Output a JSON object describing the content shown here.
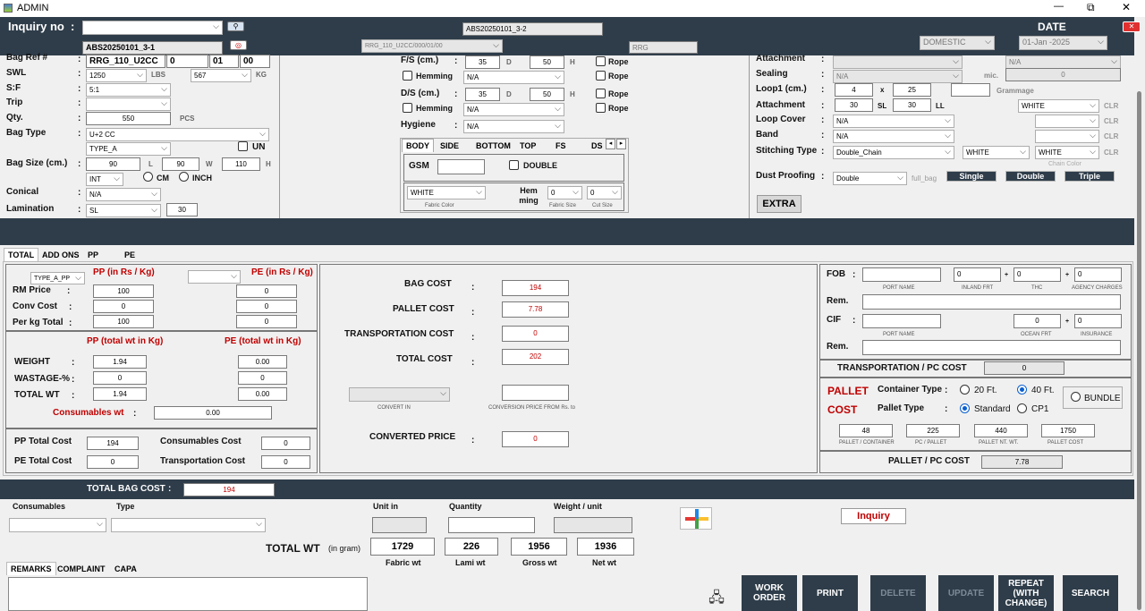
{
  "window": {
    "title": "ADMIN",
    "minimize": "—",
    "maximize": "⧉",
    "close": "✕"
  },
  "header": {
    "inquiry_label": "Inquiry no",
    "colon": ":",
    "inquiry_value": "",
    "inquiry_no_2": "ABS20250101_3-1",
    "center_value": "ABS20250101_3-2",
    "rrg_select": "RRG_110_U2CC/000/01/00",
    "rrg_text": "RRG",
    "date_label": "DATE",
    "market": "DOMESTIC",
    "date_value": "01-Jan -2025"
  },
  "left": {
    "bagref_label": "Bag Ref #",
    "bagref_value": "RRG_110_U2CC",
    "bagref_2": "0",
    "bagref_3": "01",
    "bagref_4": "00",
    "swl_label": "SWL",
    "swl_value": "1250",
    "lbs_label": "LBS",
    "lbs_value": "567",
    "kg_label": "KG",
    "sf_label": "S:F",
    "sf_value": "5:1",
    "trip_label": "Trip",
    "trip_value": "",
    "qty_label": "Qty.",
    "qty_value": "550",
    "pcs_label": "PCS",
    "bagtype_label": "Bag Type",
    "bagtype_value": "U+2 CC",
    "bagtype_sub": "TYPE_A",
    "un_label": "UN",
    "bagsize_label": "Bag Size (cm.)",
    "bs_l": "90",
    "l_label": "L",
    "bs_w": "90",
    "w_label": "W",
    "bs_h": "110",
    "h_label": "H",
    "unit_select": "INT",
    "cm_label": "CM",
    "inch_label": "INCH",
    "conical_label": "Conical",
    "conical_value": "N/A",
    "lamination_label": "Lamination",
    "lamination_value": "SL",
    "lamination_num": "30"
  },
  "mid": {
    "fs_label": "F/S (cm.)",
    "fs_d": "35",
    "fs_h": "50",
    "d_label": "D",
    "h_label": "H",
    "rope_label": "Rope",
    "hemming_label": "Hemming",
    "hem_value": "N/A",
    "ds_label": "D/S (cm.)",
    "ds_d": "35",
    "ds_h": "50",
    "hygiene_label": "Hygiene",
    "hygiene_value": "N/A",
    "tabs": [
      "BODY",
      "SIDE",
      "BOTTOM",
      "TOP",
      "FS",
      "DS"
    ],
    "gsm_label": "GSM",
    "gsm_value": "",
    "double_label": "DOUBLE",
    "fabric_color": "WHITE",
    "fabric_color_label": "Fabric Color",
    "hem_label": "Hem ming",
    "fabric_size": "0",
    "fabric_size_label": "Fabric Size",
    "cut_size": "0",
    "cut_size_label": "Cut Size"
  },
  "right": {
    "attachment_label": "Attachment",
    "attach_na": "N/A",
    "sealing_label": "Sealing",
    "sealing_value": "N/A",
    "mic_label": "mic.",
    "mic_value": "0",
    "loop1_label": "Loop1 (cm.)",
    "loop1_a": "4",
    "x_label": "x",
    "loop1_b": "25",
    "grammage_label": "Grammage",
    "grammage_value": "",
    "attachment2_label": "Attachment",
    "att_a": "30",
    "sl_label": "SL",
    "att_b": "30",
    "ll_label": "LL",
    "att_color": "WHITE",
    "loopcover_label": "Loop Cover",
    "loopcover_value": "N/A",
    "band_label": "Band",
    "band_value": "N/A",
    "stitching_label": "Stitching Type",
    "stitching_value": "Double_Chain",
    "stitch_c1": "WHITE",
    "stitch_c2": "WHITE",
    "chain_color_label": "Chain Color",
    "dust_label": "Dust Proofing",
    "dust_value": "Double",
    "full_bag_label": "full_bag",
    "single_btn": "Single",
    "double_btn": "Double",
    "triple_btn": "Triple",
    "extra_btn": "EXTRA",
    "clr_label": "CLR"
  },
  "costtabs": [
    "TOTAL",
    "ADD ONS",
    "PP",
    "PE"
  ],
  "rm": {
    "type_select": "TYPE_A_PP",
    "pp_head": "PP (in Rs / Kg)",
    "pe_head": "PE (in Rs / Kg)",
    "rm_price_label": "RM Price",
    "rm_pp": "100",
    "rm_pe": "0",
    "conv_label": "Conv Cost",
    "conv_pp": "0",
    "conv_pe": "0",
    "perkg_label": "Per kg Total",
    "perkg_pp": "100",
    "perkg_pe": "0",
    "pp_wt_head": "PP (total wt in Kg)",
    "pe_wt_head": "PE (total wt in Kg)",
    "weight_label": "WEIGHT",
    "weight_pp": "1.94",
    "weight_pe": "0.00",
    "wastage_label": "WASTAGE-%",
    "wastage_pp": "0",
    "wastage_pe": "0",
    "totalwt_label": "TOTAL WT",
    "totalwt_pp": "1.94",
    "totalwt_pe": "0.00",
    "consumables_wt_label": "Consumables wt",
    "consumables_wt": "0.00",
    "pp_total_label": "PP Total Cost",
    "pp_total": "194",
    "consumables_cost_label": "Consumables Cost",
    "consumables_cost": "0",
    "pe_total_label": "PE Total Cost",
    "pe_total": "0",
    "transport_cost_label": "Transportation Cost",
    "transport_cost": "0"
  },
  "costs": {
    "bag_cost_label": "BAG COST",
    "bag_cost": "194",
    "pallet_cost_label": "PALLET COST",
    "pallet_cost": "7.78",
    "transport_label": "TRANSPORTATION COST",
    "transport": "0",
    "total_cost_label": "TOTAL COST",
    "total_cost": "202",
    "convert_in_label": "CONVERT IN",
    "conversion_label": "CONVERSION PRICE FROM Rs. to",
    "converted_label": "CONVERTED PRICE",
    "converted": "0"
  },
  "freight": {
    "fob_label": "FOB",
    "port_name_label": "PORT NAME",
    "inland_label": "INLAND FRT",
    "inland": "0",
    "thc_label": "THC",
    "thc": "0",
    "agency_label": "AGENCY CHARGES",
    "agency": "0",
    "rem_label": "Rem.",
    "cif_label": "CIF",
    "ocean_label": "OCEAN FRT",
    "ocean": "0",
    "insurance_label": "INSURANCE",
    "insurance": "0",
    "trans_pc_label": "TRANSPORTATION / PC COST",
    "trans_pc": "0",
    "pallet_label": "PALLET",
    "cost_label": "COST",
    "container_label": "Container Type",
    "c20": "20 Ft.",
    "c40": "40 Ft.",
    "bundle": "BUNDLE",
    "pallet_type_label": "Pallet Type",
    "standard": "Standard",
    "cp1": "CP1",
    "p_container": "48",
    "p_container_label": "PALLET / CONTAINER",
    "pc_pallet": "225",
    "pc_pallet_label": "PC / PALLET",
    "net_wt": "440",
    "net_wt_label": "PALLET NT. WT.",
    "p_cost": "1750",
    "p_cost_label": "PALLET COST",
    "pallet_pc_label": "PALLET / PC COST",
    "pallet_pc": "7.78"
  },
  "bottom": {
    "total_bag_cost_label": "TOTAL BAG COST",
    "total_bag_cost": "194",
    "consumables_label": "Consumables",
    "type_label": "Type",
    "unit_in_label": "Unit in",
    "quantity_label": "Quantity",
    "weight_unit_label": "Weight / unit",
    "inquiry_btn": "Inquiry",
    "total_wt_label": "TOTAL WT",
    "in_gram": "(in gram)",
    "fabric_wt": "1729",
    "fabric_wt_label": "Fabric wt",
    "lami_wt": "226",
    "lami_wt_label": "Lami wt",
    "gross_wt": "1956",
    "gross_wt_label": "Gross wt",
    "net_wt": "1936",
    "net_wt_label": "Net wt",
    "tabs": [
      "REMARKS",
      "COMPLAINT",
      "CAPA"
    ],
    "work_order": "WORK ORDER",
    "print": "PRINT",
    "delete": "DELETE",
    "update": "UPDATE",
    "repeat": "REPEAT (WITH CHANGE)",
    "search": "SEARCH"
  }
}
